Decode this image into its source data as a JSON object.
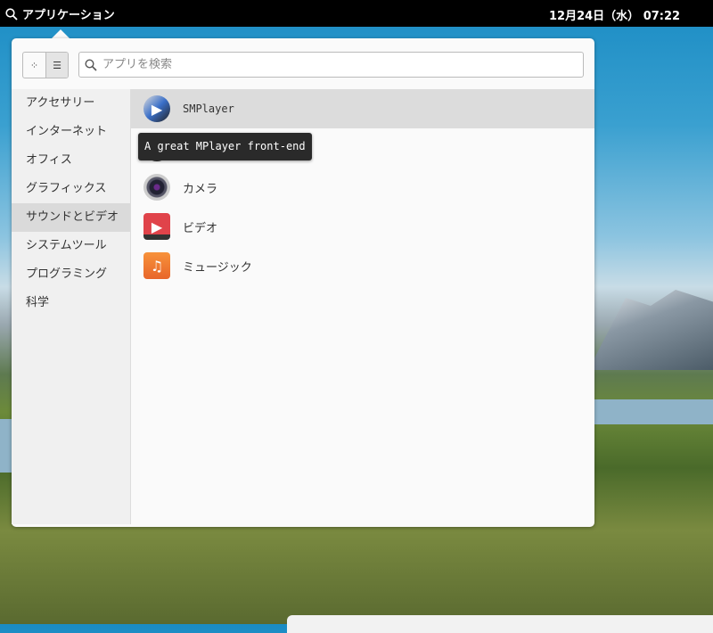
{
  "topbar": {
    "apps_label": "アプリケーション",
    "clock": "12月24日（水） 07:22"
  },
  "search": {
    "placeholder": "アプリを検索",
    "value": ""
  },
  "categories": [
    "アクセサリー",
    "インターネット",
    "オフィス",
    "グラフィックス",
    "サウンドとビデオ",
    "システムツール",
    "プログラミング",
    "科学"
  ],
  "selected_category": "サウンドとビデオ",
  "apps": [
    {
      "label": "SMPlayer",
      "icon": "smplayer-icon"
    },
    {
      "label": "",
      "icon": "obscured-app-icon"
    },
    {
      "label": "カメラ",
      "icon": "camera-icon"
    },
    {
      "label": "ビデオ",
      "icon": "video-icon"
    },
    {
      "label": "ミュージック",
      "icon": "music-icon"
    }
  ],
  "tooltip": "A great MPlayer front-end"
}
